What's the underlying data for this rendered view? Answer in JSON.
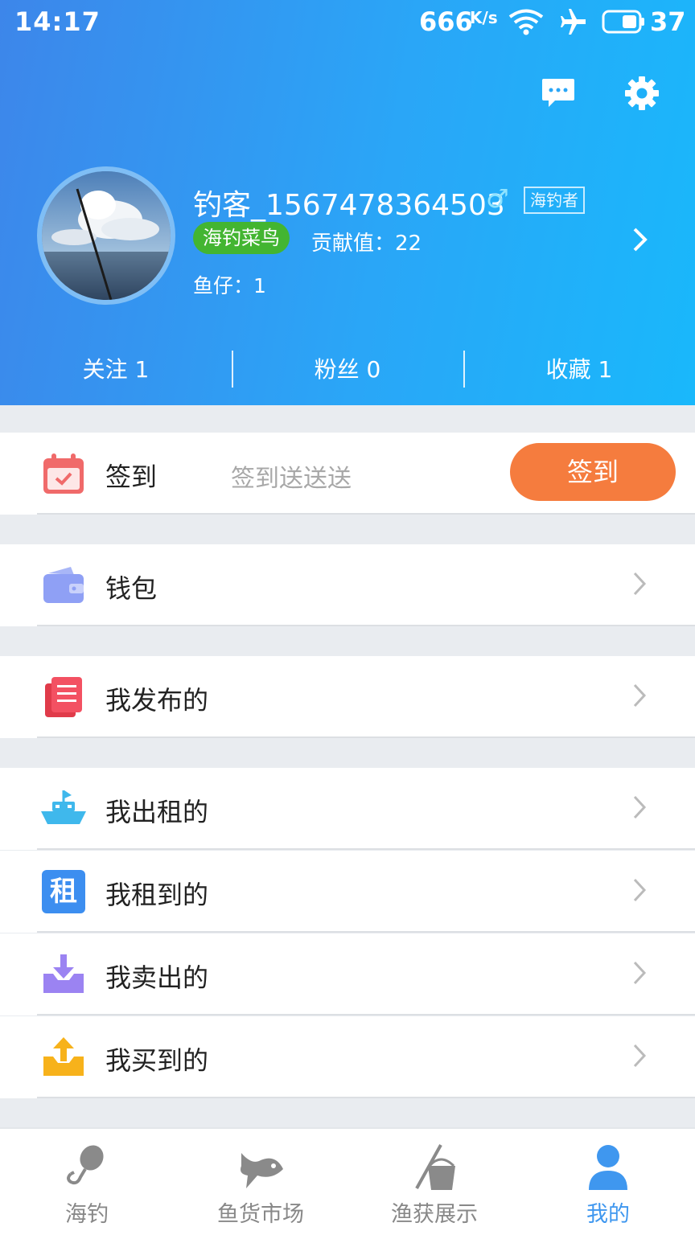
{
  "status_bar": {
    "time": "14:17",
    "net_speed": "666",
    "net_speed_unit": "K/s",
    "battery_level": "37",
    "icons": [
      "wifi-icon",
      "airplane-icon",
      "battery-icon"
    ]
  },
  "header": {
    "icons": [
      "message-icon",
      "settings-icon"
    ],
    "username": "钓客_1567478364503",
    "gender_symbol": "♂",
    "role_badge": "海钓者",
    "level_badge": "海钓菜鸟",
    "contribution": "贡献值：22",
    "fish_fry": "鱼仔：1",
    "stats": [
      {
        "label": "关注 1"
      },
      {
        "label": "粉丝 0"
      },
      {
        "label": "收藏 1"
      }
    ]
  },
  "checkin": {
    "label": "签到",
    "hint": "签到送送送",
    "button": "签到"
  },
  "menu": {
    "wallet": "钱包",
    "published": "我发布的",
    "rented_out": "我出租的",
    "rented_in": "我租到的",
    "sold": "我卖出的",
    "bought": "我买到的",
    "rent_icon_char": "租"
  },
  "tabs": [
    {
      "label": "海钓",
      "icon": "fishing-hook-icon"
    },
    {
      "label": "鱼货市场",
      "icon": "fish-icon"
    },
    {
      "label": "渔获展示",
      "icon": "catch-bucket-icon"
    },
    {
      "label": "我的",
      "icon": "profile-icon",
      "active": true
    }
  ],
  "colors": {
    "header_start": "#3d86ea",
    "header_end": "#19b8fb",
    "checkin_button": "#f57c3e",
    "level_badge": "#43b531",
    "active_tab": "#3f97ef"
  }
}
